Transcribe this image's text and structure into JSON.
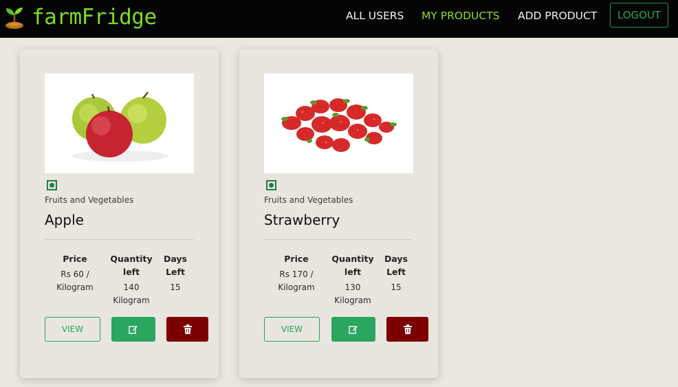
{
  "brand": {
    "name": "farmFridge"
  },
  "nav": {
    "all_users": "ALL USERS",
    "my_products": "MY PRODUCTS",
    "add_product": "ADD PRODUCT",
    "logout": "LOGOUT"
  },
  "colors": {
    "navbar": "#050505",
    "brand": "#7ddc1f",
    "active_link": "#8fdc2a",
    "view": "#27a458",
    "edit": "#2aa660",
    "delete": "#7c0000"
  },
  "products": [
    {
      "image_icon": "apple-image",
      "category": "Fruits and Vegetables",
      "name": "Apple",
      "price_label": "Price",
      "price_value": "Rs 60 /",
      "price_unit": "Kilogram",
      "qty_label_1": "Quantity",
      "qty_label_2": "left",
      "qty_value": "140",
      "qty_unit": "Kilogram",
      "days_label_1": "Days",
      "days_label_2": "Left",
      "days_value": "15",
      "view_label": "VIEW",
      "edit_icon": "edit-icon",
      "delete_icon": "trash-icon"
    },
    {
      "image_icon": "strawberry-image",
      "category": "Fruits and Vegetables",
      "name": "Strawberry",
      "price_label": "Price",
      "price_value": "Rs 170 /",
      "price_unit": "Kilogram",
      "qty_label_1": "Quantity",
      "qty_label_2": "left",
      "qty_value": "130",
      "qty_unit": "Kilogram",
      "days_label_1": "Days",
      "days_label_2": "Left",
      "days_value": "15",
      "view_label": "VIEW",
      "edit_icon": "edit-icon",
      "delete_icon": "trash-icon"
    }
  ]
}
